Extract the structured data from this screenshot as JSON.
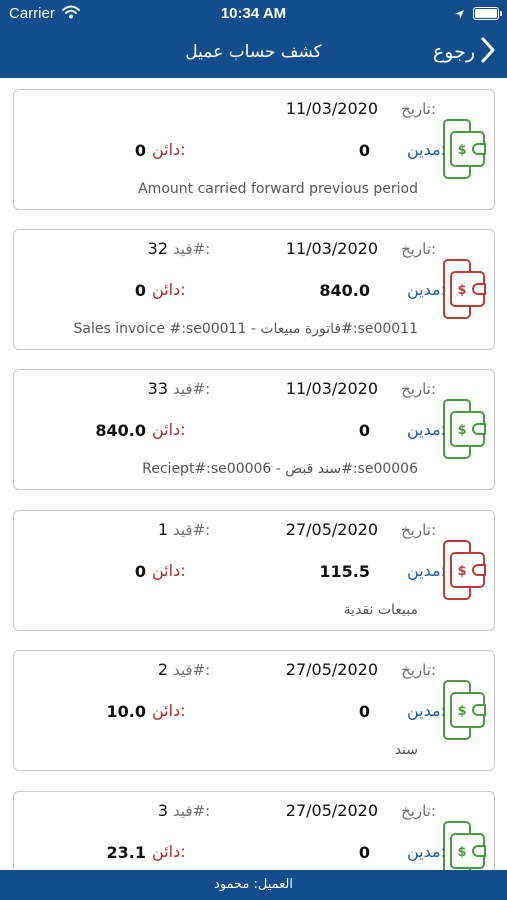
{
  "status_bar": {
    "carrier": "Carrier",
    "time": "10:34 AM"
  },
  "header": {
    "title": "كشف حساب عميل",
    "back_label": "رجوع"
  },
  "labels": {
    "date": "تاريخ:",
    "entry": "قيد#:",
    "debit": "مدين:",
    "credit": "دائن:"
  },
  "colors": {
    "header_bg": "#134d8e",
    "green_icon": "#4a9a3f",
    "red_icon": "#c03a3a",
    "debit_label": "#1d5ea6",
    "credit_label": "#b02a2a"
  },
  "entries": [
    {
      "date": "11/03/2020",
      "entry_no": "",
      "debit": "0",
      "credit": "0",
      "description": "Amount carried forward previous period",
      "icon": "wallet-phone-icon",
      "icon_color": "green"
    },
    {
      "date": "11/03/2020",
      "entry_no": "32",
      "debit": "840.0",
      "credit": "0",
      "description": "Sales invoice #:se00011 - فاتورة مبيعات#:se00011",
      "icon": "wallet-phone-icon",
      "icon_color": "red"
    },
    {
      "date": "11/03/2020",
      "entry_no": "33",
      "debit": "0",
      "credit": "840.0",
      "description": "Reciept#:se00006 - سند قبض#:se00006",
      "icon": "wallet-phone-icon",
      "icon_color": "green"
    },
    {
      "date": "27/05/2020",
      "entry_no": "1",
      "debit": "115.5",
      "credit": "0",
      "description": "مبيعات نقدية",
      "icon": "wallet-phone-icon",
      "icon_color": "red"
    },
    {
      "date": "27/05/2020",
      "entry_no": "2",
      "debit": "0",
      "credit": "10.0",
      "description": "سند",
      "icon": "wallet-phone-icon",
      "icon_color": "green"
    },
    {
      "date": "27/05/2020",
      "entry_no": "3",
      "debit": "0",
      "credit": "23.1",
      "description": "",
      "icon": "wallet-phone-icon",
      "icon_color": "green"
    }
  ],
  "footer": {
    "customer": "العميل: محمود"
  }
}
